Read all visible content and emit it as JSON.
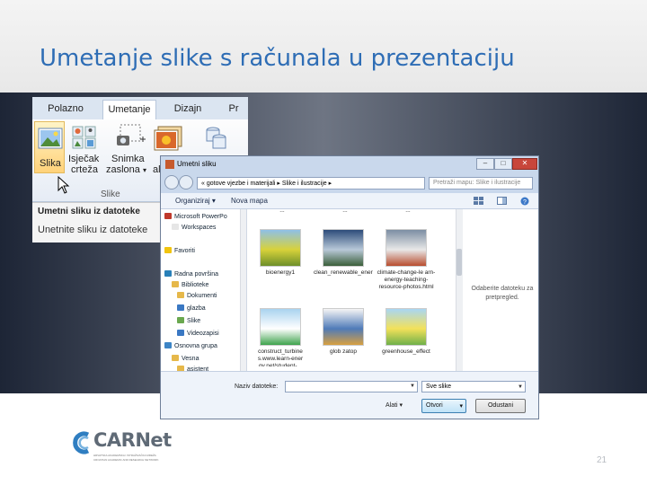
{
  "slide": {
    "title": "Umetanje slike s računala u prezentaciju",
    "page_number": "21"
  },
  "ribbon": {
    "tabs": [
      "Polazno",
      "Umetanje",
      "Dizajn",
      "Pr"
    ],
    "active_tab": "Umetanje",
    "buttons": {
      "picture": "Slika",
      "clipart_1": "Isječak",
      "clipart_2": "crteža",
      "screenshot_1": "Snimka",
      "screenshot_2": "zaslona",
      "screenshot_arrow": "▾",
      "album_partial": "al"
    },
    "group_label": "Slike",
    "tooltip": {
      "title": "Umetni sliku iz datoteke",
      "text": "Unetnite sliku iz datoteke"
    }
  },
  "dialog": {
    "title": "Umetni sliku",
    "window_controls": {
      "minimize": "–",
      "maximize": "□",
      "close": "✕"
    },
    "address": "« gotove vjezbe i materijali ▸ Slike i ilustracije ▸",
    "search_placeholder": "Pretraži mapu: Slike i ilustracije",
    "toolbar": {
      "organize": "Organiziraj ▾",
      "new_folder": "Nova mapa"
    },
    "nav_items": [
      {
        "label": "Microsoft PowerPo",
        "color": "#c0392b"
      },
      {
        "label": "Workspaces",
        "color": "#e6e6e6"
      },
      {
        "label": "Favoriti",
        "color": "#f1c40f"
      },
      {
        "label": "Radna površina",
        "color": "#2980b9"
      },
      {
        "label": "Biblioteke",
        "color": "#e6b84a"
      },
      {
        "label": "Dokumenti",
        "color": "#e6b84a"
      },
      {
        "label": "glazba",
        "color": "#3a78c3"
      },
      {
        "label": "Slike",
        "color": "#6aa84f"
      },
      {
        "label": "Videozapisi",
        "color": "#3a78c3"
      },
      {
        "label": "Osnovna grupa",
        "color": "#3d85c6"
      },
      {
        "label": "Vesna",
        "color": "#e6b84a"
      },
      {
        "label": "asistent",
        "color": "#e6b84a"
      }
    ],
    "files": [
      {
        "caption": "bioenergy1",
        "palette": [
          "#8ec0e8",
          "#d8d23a",
          "#6d8f2a"
        ]
      },
      {
        "caption": "clean_renewable_energy",
        "palette": [
          "#2d4c7a",
          "#b8c8d8",
          "#3a5f3a"
        ]
      },
      {
        "caption": "climate-change-le arn-energy-teaching-resource-photos.html",
        "palette": [
          "#7c8ea3",
          "#e8e8e8",
          "#b84d2e"
        ]
      },
      {
        "caption": "construct_turbine s.www.learn-ener gy.net/student-...",
        "palette": [
          "#a9d3ef",
          "#ffffff",
          "#3fa34d"
        ]
      },
      {
        "caption": "glob zatop",
        "palette": [
          "#f5f5f5",
          "#4f7bb8",
          "#d8a040"
        ]
      },
      {
        "caption": "greenhouse_effect",
        "palette": [
          "#a9d6f2",
          "#f3e15a",
          "#6fb04a"
        ]
      }
    ],
    "top_row_captions": [
      "...",
      "...",
      "..."
    ],
    "preview_text": "Odaberite datoteku za pretpregled.",
    "file_name_label": "Naziv datoteke:",
    "file_name_value": "",
    "file_type": "Sve slike",
    "tools_label": "Alati ▾",
    "open_button": "Otvori",
    "open_arrow": "▾",
    "cancel_button": "Odustani"
  },
  "logo": {
    "text": "CARNet",
    "sub1": "HRVATSKA AKADEMSKA I ISTRAŽIVAČKA MREŽA",
    "sub2": "CROATIAN ACADEMIC AND RESEARCH NETWORK"
  }
}
